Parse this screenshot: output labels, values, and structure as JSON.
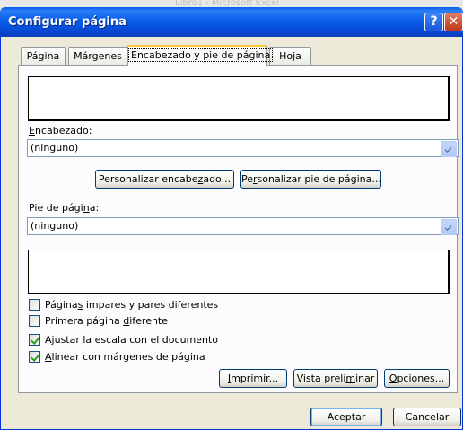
{
  "background": {
    "title_fragment": "Libro1 - Microsoft Excel"
  },
  "dialog": {
    "title": "Configurar página",
    "help_label": "?",
    "close_label": "✕"
  },
  "tabs": [
    {
      "label": "Página"
    },
    {
      "label": "Márgenes"
    },
    {
      "label": "Encabezado y pie de página"
    },
    {
      "label": "Hoja"
    }
  ],
  "header": {
    "label_first": "E",
    "label_rest": "ncabezado:",
    "selected": "(ninguno)",
    "custom_header_pre": "Personalizar encabe",
    "custom_header_key": "z",
    "custom_header_post": "ado...",
    "custom_footer_pre": "Pe",
    "custom_footer_key": "r",
    "custom_footer_post": "sonalizar pie de página..."
  },
  "footer": {
    "label_pre": "Pie de pági",
    "label_key": "n",
    "label_post": "a:",
    "selected": "(ninguno)"
  },
  "options": [
    {
      "pre": "Página",
      "key": "s",
      "post": " impares y pares diferentes",
      "checked": false
    },
    {
      "pre": "Primera página ",
      "key": "d",
      "post": "iferente",
      "checked": false
    },
    {
      "pre": "A",
      "key": "j",
      "post": "ustar la escala con el documento",
      "checked": true
    },
    {
      "pre": "",
      "key": "A",
      "post": "linear con márgenes de página",
      "checked": true
    }
  ],
  "actions": {
    "print_key": "I",
    "print_rest": "mprimir...",
    "preview_pre": "Vista preli",
    "preview_key": "m",
    "preview_post": "inar",
    "options_key": "O",
    "options_rest": "pciones..."
  },
  "footer_buttons": {
    "ok": "Aceptar",
    "cancel": "Cancelar"
  }
}
